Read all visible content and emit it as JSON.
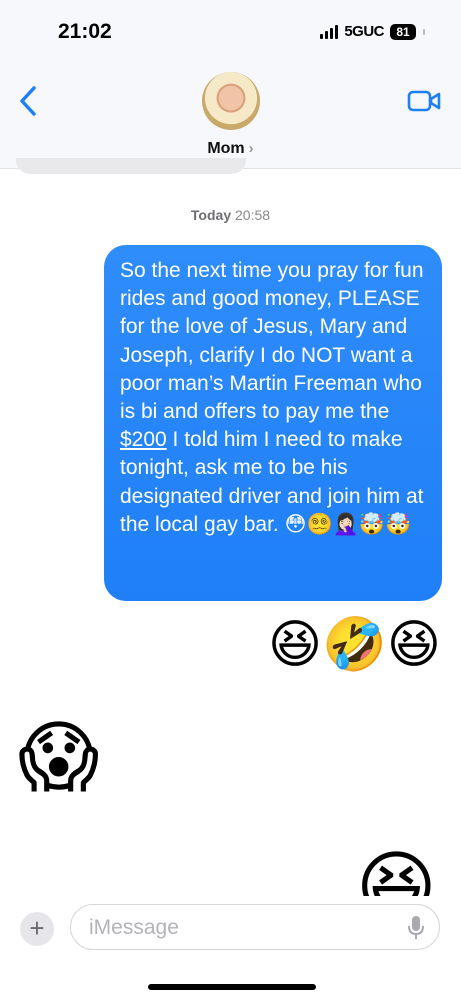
{
  "status": {
    "time": "21:02",
    "network": "5GUC",
    "battery": "81"
  },
  "header": {
    "contact_name": "Mom",
    "back_icon": "chevron-left-icon",
    "video_icon": "video-camera-icon"
  },
  "thread": {
    "timestamp_day": "Today",
    "timestamp_time": "20:58",
    "outgoing_text_1": "So the next time you pray for fun rides and good money, PLEASE for the love of Jesus, Mary and Joseph, clarify I do NOT want a poor man’s Martin Freeman who is bi and offers to pay me the ",
    "outgoing_link": "$200",
    "outgoing_text_2": " I told him I need to make tonight, ask me to be his designated driver and join him at the local gay bar. 😳😵‍💫🤦🏻‍♀️🤯🤯",
    "outgoing_emojis": "😆🤣😆",
    "incoming_emoji": "😱",
    "outgoing_emoji_partial": "😆"
  },
  "composer": {
    "placeholder": "iMessage",
    "value": "",
    "plus_label": "+",
    "mic_icon": "microphone-icon"
  },
  "colors": {
    "accent": "#1f7ff7",
    "header_bg": "#f6f8fb"
  }
}
